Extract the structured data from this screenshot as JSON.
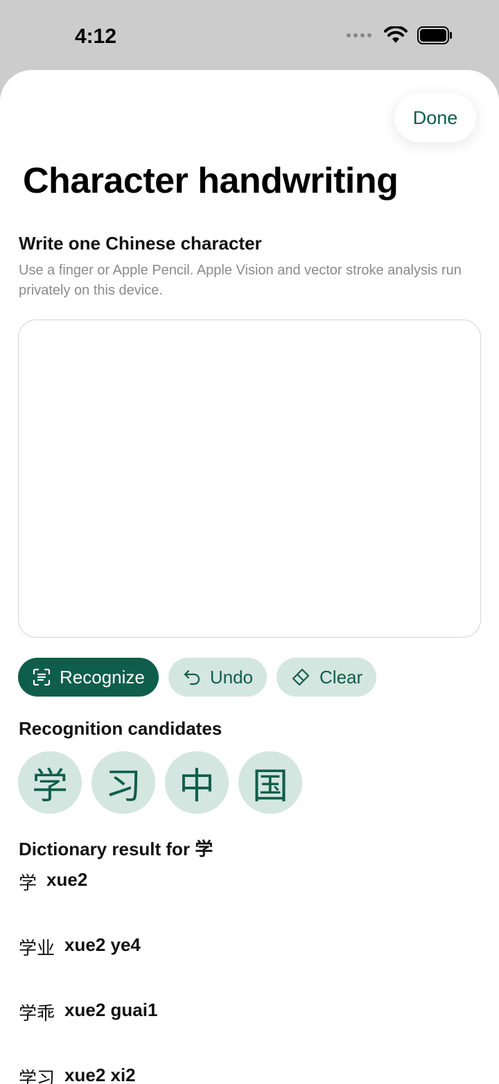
{
  "status": {
    "time": "4:12"
  },
  "header": {
    "done_label": "Done",
    "title": "Character handwriting"
  },
  "prompt": {
    "heading": "Write one Chinese character",
    "hint": "Use a finger or Apple Pencil. Apple Vision and vector stroke analysis run privately on this device."
  },
  "toolbar": {
    "recognize_label": "Recognize",
    "undo_label": "Undo",
    "clear_label": "Clear"
  },
  "candidates": {
    "heading": "Recognition candidates",
    "items": [
      "学",
      "习",
      "中",
      "国"
    ]
  },
  "dictionary": {
    "heading": "Dictionary result for 学",
    "entries": [
      {
        "hanzi": "学",
        "pinyin": "xue2"
      },
      {
        "hanzi": "学业",
        "pinyin": "xue2 ye4"
      },
      {
        "hanzi": "学乖",
        "pinyin": "xue2 guai1"
      },
      {
        "hanzi": "学习",
        "pinyin": "xue2 xi2"
      }
    ]
  },
  "colors": {
    "accent": "#0f5e4b",
    "accent_soft": "#d3e6df"
  },
  "icons": {
    "recognize": "text-viewfinder-icon",
    "undo": "undo-arrow-icon",
    "clear": "eraser-icon"
  }
}
